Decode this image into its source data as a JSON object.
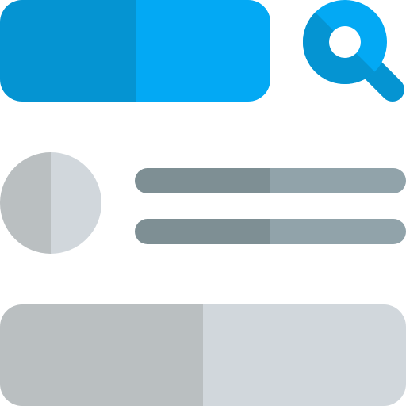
{
  "colors": {
    "blue_dark": "#0594d2",
    "blue_light": "#03a9f4",
    "gray_left": "#babfc1",
    "gray_right": "#d1d7dc",
    "line_dark": "#7e8f94",
    "line_light": "#91a3aa",
    "white": "#ffffff"
  },
  "icons": {
    "search": "search-icon"
  }
}
